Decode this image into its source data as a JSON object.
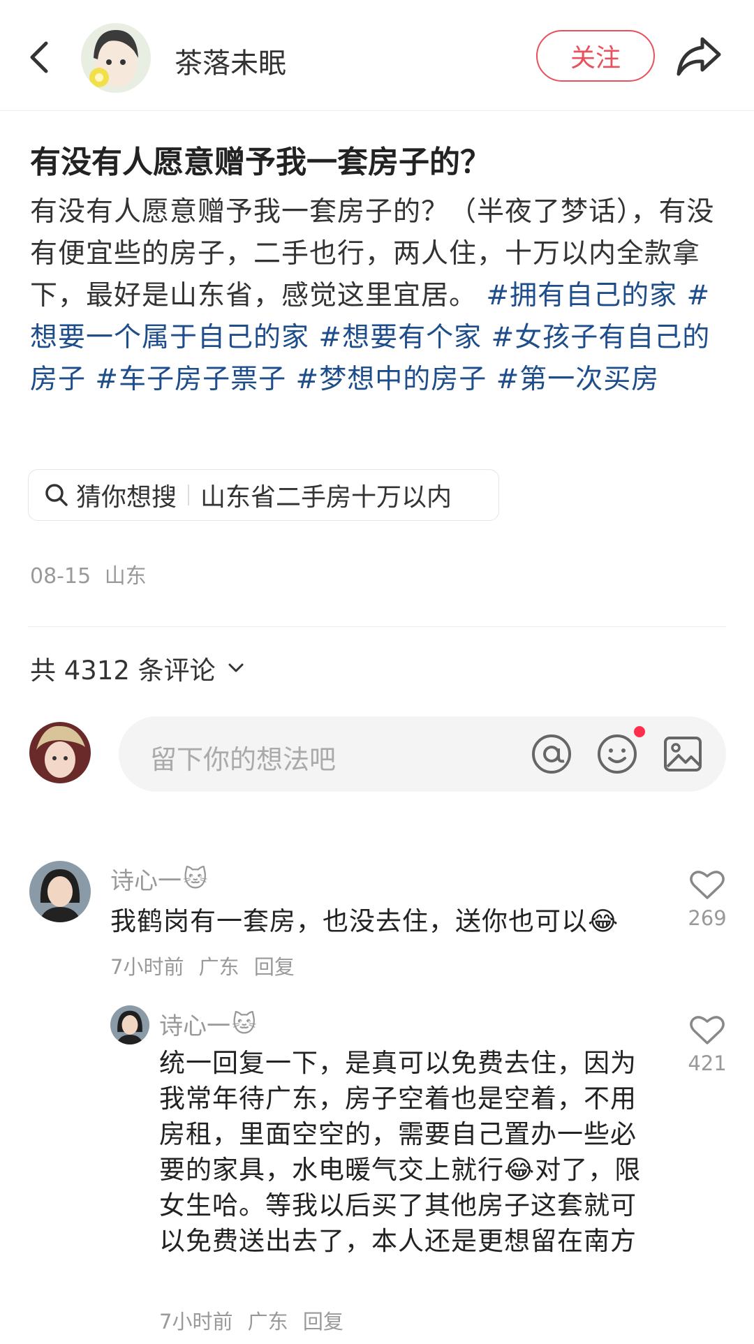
{
  "header": {
    "author_name": "茶落未眠",
    "follow_label": "关注"
  },
  "post": {
    "title": "有没有人愿意赠予我一套房子的？",
    "body_text": "有没有人愿意赠予我一套房子的？（半夜了梦话），有没有便宜些的房子，二手也行，两人住，十万以内全款拿下，最好是山东省，感觉这里宜居。",
    "tags": [
      "#拥有自己的家",
      "#想要一个属于自己的家",
      "#想要有个家",
      "#女孩子有自己的房子",
      "#车子房子票子",
      "#梦想中的房子",
      "#第一次买房"
    ],
    "search_prefix": "猜你想搜",
    "search_suggestion": "山东省二手房十万以内",
    "date": "08-15",
    "location": "山东"
  },
  "comments_header": {
    "count_text": "共 4312 条评论"
  },
  "composer": {
    "placeholder": "留下你的想法吧"
  },
  "comments": [
    {
      "author": "诗心一",
      "text": "我鹤岗有一套房，也没去住，送你也可以",
      "time": "7小时前",
      "location": "广东",
      "reply_label": "回复",
      "likes": "269"
    },
    {
      "author": "诗心一",
      "text": "统一回复一下，是真可以免费去住，因为我常年待广东，房子空着也是空着，不用房租，里面空空的，需要自己置办一些必要的家具，水电暖气交上就行",
      "text_2": "对了，限女生哈。等我以后买了其他房子这套就可以免费送出去了，本人还是更想留在南方",
      "time": "7小时前",
      "location": "广东",
      "reply_label": "回复",
      "likes": "421"
    }
  ],
  "colors": {
    "accent": "#e8505b",
    "tag": "#1e4d8c",
    "notification_dot": "#ff2e4d"
  }
}
